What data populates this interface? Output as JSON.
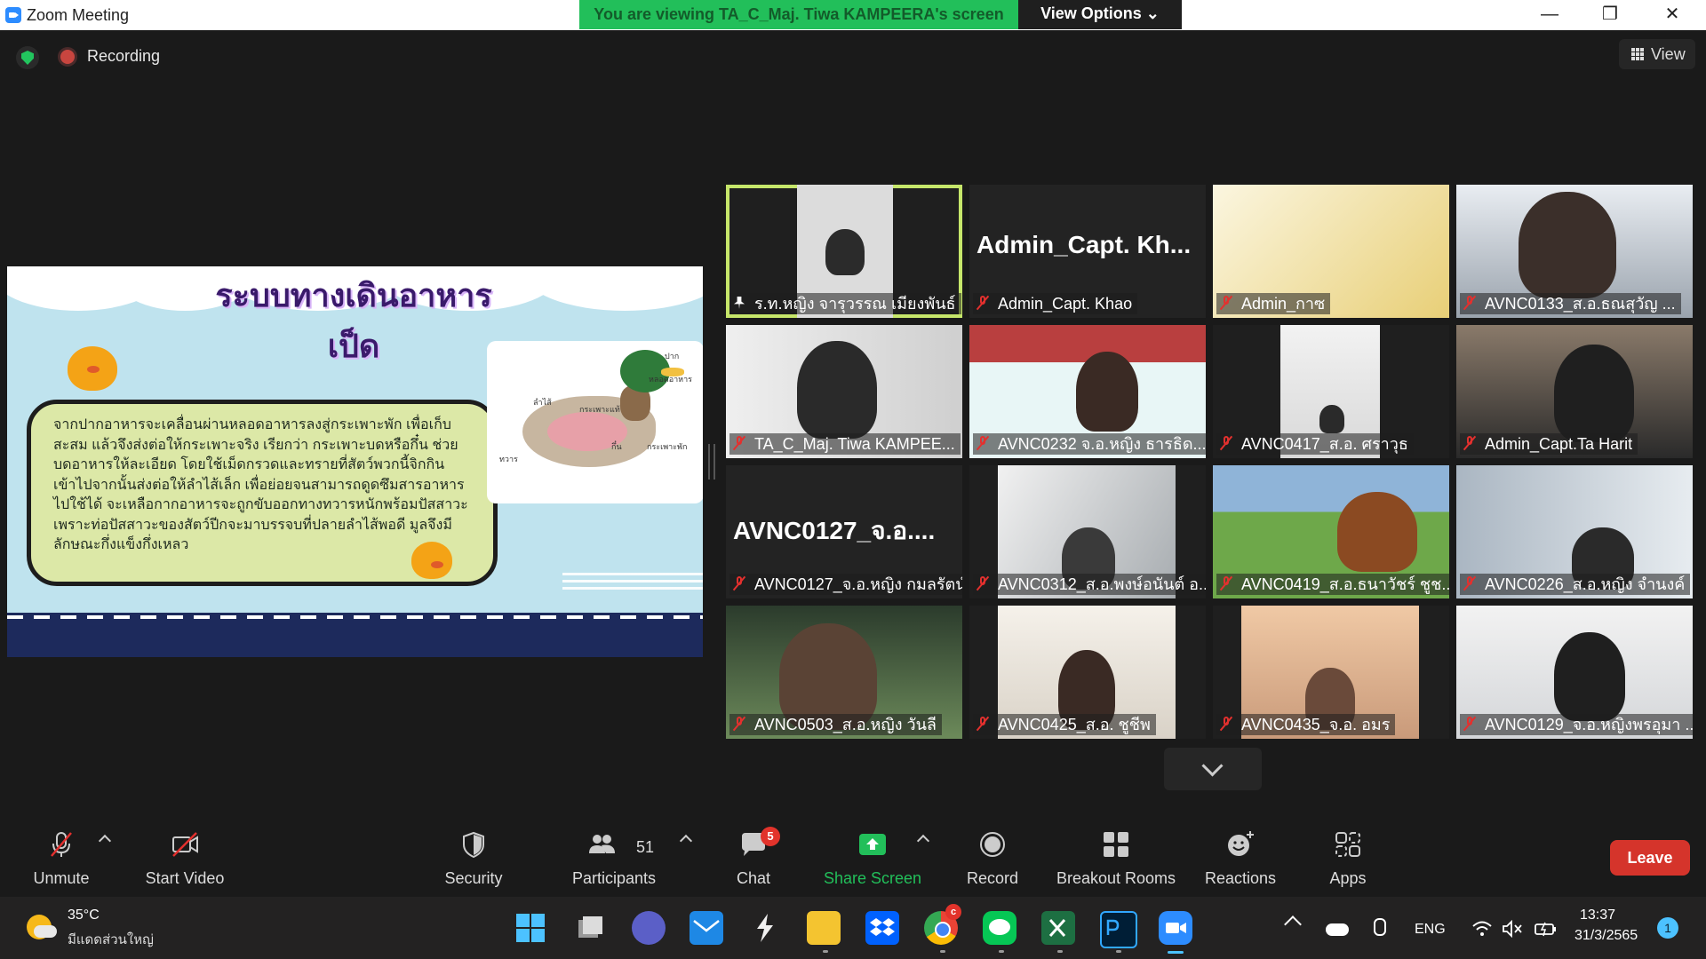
{
  "window": {
    "title": "Zoom Meeting",
    "viewing_banner": "You are viewing TA_C_Maj. Tiwa KAMPEERA's screen",
    "view_options": "View Options ⌄",
    "controls": {
      "minimize": "—",
      "restore": "❐",
      "close": "✕"
    }
  },
  "status": {
    "recording_label": "Recording",
    "view_label": "View"
  },
  "slide": {
    "title": "ระบบทางเดินอาหารเป็ด",
    "body": "จากปากอาหารจะเคลื่อนผ่านหลอดอาหารลงสู่กระเพาะพัก เพื่อเก็บสะสม แล้วจึงส่งต่อให้กระเพาะจริง เรียกว่า กระเพาะบดหรือกึ๋น ช่วยบดอาหารให้ละเอียด โดยใช้เม็ดกรวดและทรายที่สัตว์พวกนี้จิกกินเข้าไปจากนั้นส่งต่อให้ลำไส้เล็ก เพื่อย่อยจนสามารถดูดซึมสารอาหารไปใช้ได้ จะเหลือกากอาหารจะถูกขับออกทางทวารหนักพร้อมปัสสาวะ เพราะท่อปัสสาวะของสัตว์ปีกจะมาบรรจบที่ปลายลำไส้พอดี มูลจึงมีลักษณะกึ่งแข็งกึ่งเหลว",
    "diagram_labels": [
      "ปาก",
      "หลอดอาหาร",
      "ลำไส้",
      "กระเพาะแท้",
      "กึ๋น",
      "กระเพาะพัก",
      "ทวาร"
    ]
  },
  "participants": [
    {
      "name": "ร.ท.หญิง จารุวรรณ เมียงพันธ์",
      "active": true,
      "pinned": true,
      "video": true,
      "big_name": ""
    },
    {
      "name": "Admin_Capt. Khao",
      "video": false,
      "big_name": "Admin_Capt. Kh..."
    },
    {
      "name": "Admin_กาซ",
      "video": true,
      "big_name": ""
    },
    {
      "name": "AVNC0133_ส.อ.ธณสุวัญ ...",
      "video": true,
      "big_name": ""
    },
    {
      "name": "TA_C_Maj. Tiwa KAMPEE...",
      "video": true,
      "big_name": ""
    },
    {
      "name": "AVNC0232 จ.อ.หญิง ธารธิด...",
      "video": true,
      "big_name": ""
    },
    {
      "name": "AVNC0417_ส.อ. ศราวุธ",
      "video": true,
      "big_name": ""
    },
    {
      "name": "Admin_Capt.Ta Harit",
      "video": true,
      "big_name": ""
    },
    {
      "name": "AVNC0127_จ.อ.หญิง กมลรัตน์",
      "video": false,
      "big_name": "AVNC0127_จ.อ...."
    },
    {
      "name": "AVNC0312_ส.อ.พงษ์อนันต์ อ...",
      "video": true,
      "big_name": ""
    },
    {
      "name": "AVNC0419_ส.อ.ธนาวัชร์ ชูช...",
      "video": true,
      "big_name": ""
    },
    {
      "name": "AVNC0226_ส.อ.หญิง จำนงค์",
      "video": true,
      "big_name": ""
    },
    {
      "name": "AVNC0503_ส.อ.หญิง วันลี",
      "video": true,
      "big_name": ""
    },
    {
      "name": "AVNC0425_ส.อ. ชูชีพ",
      "video": true,
      "big_name": ""
    },
    {
      "name": "AVNC0435_จ.อ. อมร",
      "video": true,
      "big_name": ""
    },
    {
      "name": "AVNC0129_จ.อ.หญิงพรอุมา ...",
      "video": true,
      "big_name": ""
    }
  ],
  "toolbar": {
    "unmute": "Unmute",
    "start_video": "Start Video",
    "security": "Security",
    "participants": "Participants",
    "participants_count": "51",
    "chat": "Chat",
    "chat_badge": "5",
    "share_screen": "Share Screen",
    "record": "Record",
    "breakout_rooms": "Breakout Rooms",
    "reactions": "Reactions",
    "apps": "Apps",
    "leave": "Leave"
  },
  "taskbar": {
    "temperature": "35°C",
    "weather": "มีแดดส่วนใหญ่",
    "language": "ENG",
    "time": "13:37",
    "date": "31/3/2565",
    "notifications": "1",
    "chrome_badge": "c"
  },
  "colors": {
    "banner_green": "#22bf5a",
    "active_speaker": "#c6e66a",
    "share_green": "#22bf5a",
    "leave_red": "#d5342b",
    "muted_red": "#e3302e"
  }
}
